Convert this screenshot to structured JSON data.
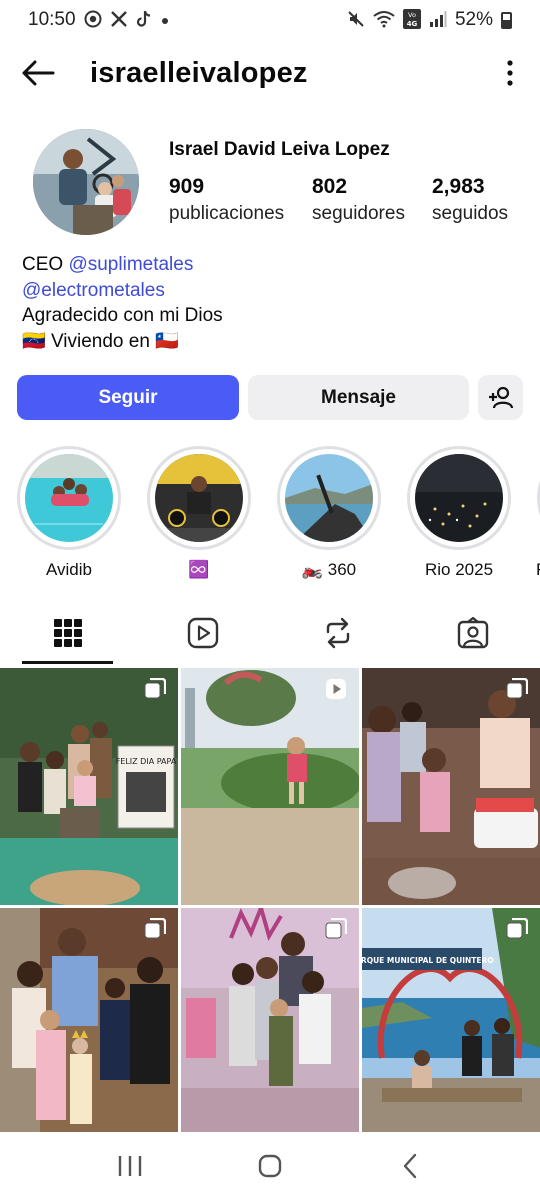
{
  "status_bar": {
    "time": "10:50",
    "battery": "52%",
    "left_icons": [
      "whatsapp-icon",
      "x-icon",
      "tiktok-icon",
      "dot-icon"
    ],
    "right_icons": [
      "mute-icon",
      "wifi-icon",
      "volte-icon",
      "signal-icon",
      "battery-icon"
    ]
  },
  "header": {
    "username": "israelleivalopez",
    "back_icon": "arrow-left-icon",
    "more_icon": "more-vertical-icon"
  },
  "profile": {
    "full_name": "Israel David Leiva Lopez",
    "stats": [
      {
        "value": "909",
        "label": "publicaciones"
      },
      {
        "value": "802",
        "label": "seguidores"
      },
      {
        "value": "2,983",
        "label": "seguidos"
      }
    ],
    "bio": {
      "line1_prefix": "CEO ",
      "mention1": "@suplimetales",
      "mention2": "@electrometales",
      "line3": "Agradecido con mi Dios",
      "line4_flag": "🇻🇪",
      "line4_text": " Viviendo en ",
      "line4_flag2": "🇨🇱"
    }
  },
  "actions": {
    "follow": "Seguir",
    "message": "Mensaje",
    "add_icon": "add-person-icon"
  },
  "highlights": [
    {
      "label": "Avidib"
    },
    {
      "label": "♾️"
    },
    {
      "label": "🏍️ 360"
    },
    {
      "label": "Rio 2025"
    },
    {
      "label": "R"
    }
  ],
  "tabs": [
    {
      "name": "grid",
      "icon": "grid-icon"
    },
    {
      "name": "reels",
      "icon": "reels-icon"
    },
    {
      "name": "reposts",
      "icon": "repost-icon"
    },
    {
      "name": "tagged",
      "icon": "tagged-icon"
    }
  ],
  "posts": [
    {
      "type": "carousel",
      "badge_icon": "carousel-icon",
      "caption_text": "FELIZ DIA PAPA"
    },
    {
      "type": "video",
      "badge_icon": "reel-icon"
    },
    {
      "type": "carousel",
      "badge_icon": "carousel-icon"
    },
    {
      "type": "carousel",
      "badge_icon": "carousel-icon"
    },
    {
      "type": "carousel",
      "badge_icon": "carousel-icon"
    },
    {
      "type": "carousel",
      "badge_icon": "carousel-icon",
      "caption_text": "PARQUE MUNICIPAL DE QUINTERO"
    }
  ],
  "navbar": {
    "items": [
      "recents-icon",
      "home-icon",
      "back-icon"
    ]
  },
  "colors": {
    "accent": "#4a5cf5",
    "mention": "#3d4bd6",
    "secondary_button": "#efeff1"
  }
}
